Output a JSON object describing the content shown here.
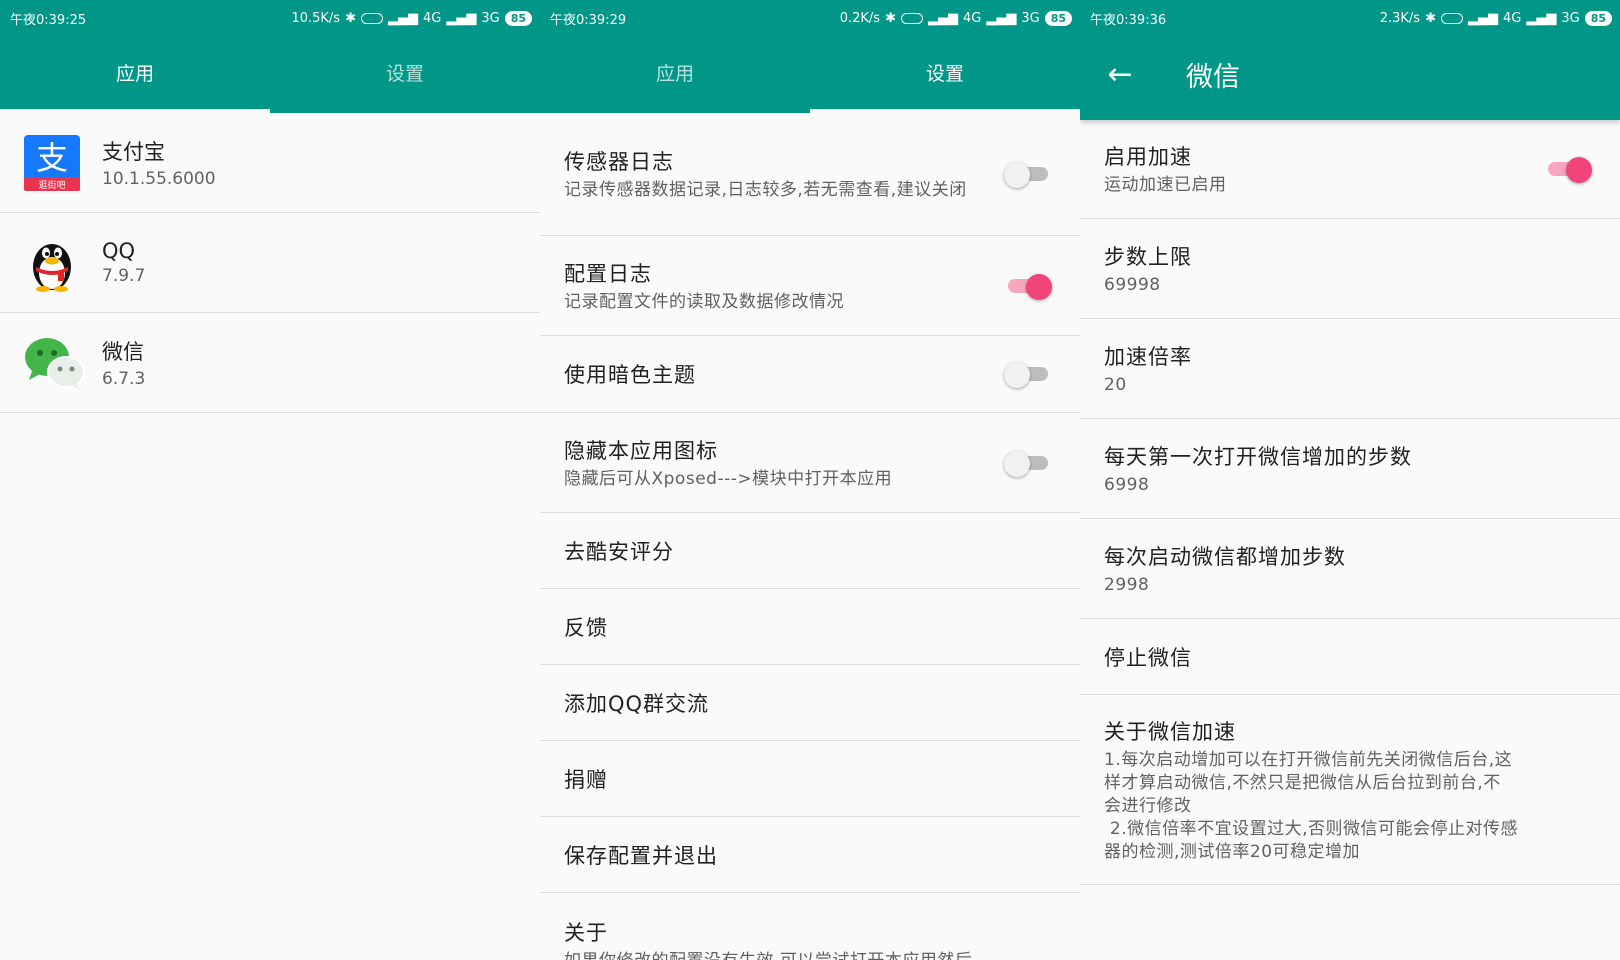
{
  "panels": [
    {
      "status": {
        "time": "午夜0:39:25",
        "speed": "10.5K/s",
        "net1": "4G",
        "net2": "3G",
        "battery": "85"
      },
      "tabs": [
        {
          "label": "应用"
        },
        {
          "label": "设置"
        }
      ],
      "apps": [
        {
          "name": "支付宝",
          "version": "10.1.55.6000",
          "icon": "alipay-icon",
          "color": "#1677ff",
          "badge": "逛街吧"
        },
        {
          "name": "QQ",
          "version": "7.9.7",
          "icon": "qq-penguin-icon"
        },
        {
          "name": "微信",
          "version": "6.7.3",
          "icon": "wechat-icon",
          "color": "#44b549"
        }
      ]
    },
    {
      "status": {
        "time": "午夜0:39:29",
        "speed": "0.2K/s",
        "net1": "4G",
        "net2": "3G",
        "battery": "85"
      },
      "tabs": [
        {
          "label": "应用"
        },
        {
          "label": "设置"
        }
      ],
      "prefs": [
        {
          "title": "传感器日志",
          "summary": "记录传感器数据记录,日志较多,若无需查看,建议关闭",
          "switch_on": false
        },
        {
          "title": "配置日志",
          "summary": "记录配置文件的读取及数据修改情况",
          "switch_on": true
        },
        {
          "title": "使用暗色主题",
          "switch_on": false
        },
        {
          "title": "隐藏本应用图标",
          "summary": "隐藏后可从Xposed--->模块中打开本应用",
          "switch_on": false
        },
        {
          "title": "去酷安评分"
        },
        {
          "title": "反馈"
        },
        {
          "title": "添加QQ群交流"
        },
        {
          "title": "捐赠"
        },
        {
          "title": "保存配置并退出"
        },
        {
          "title": "关于",
          "summary": "如果你修改的配置没有生效,可以尝试打开本应用然后"
        }
      ]
    },
    {
      "status": {
        "time": "午夜0:39:36",
        "speed": "2.3K/s",
        "net1": "4G",
        "net2": "3G",
        "battery": "85"
      },
      "title": "微信",
      "prefs": [
        {
          "title": "启用加速",
          "summary": "运动加速已启用",
          "switch_on": true
        },
        {
          "title": "步数上限",
          "summary": "69998"
        },
        {
          "title": "加速倍率",
          "summary": "20"
        },
        {
          "title": "每天第一次打开微信增加的步数",
          "summary": "6998"
        },
        {
          "title": "每次启动微信都增加步数",
          "summary": "2998"
        },
        {
          "title": "停止微信"
        },
        {
          "title": "关于微信加速",
          "summary_lines": [
            "1.每次启动增加可以在打开微信前先关闭微信后台,这",
            "样才算启动微信,不然只是把微信从后台拉到前台,不",
            "会进行修改",
            " 2.微信倍率不宜设置过大,否则微信可能会停止对传感",
            "器的检测,测试倍率20可稳定增加"
          ]
        }
      ]
    }
  ],
  "colors": {
    "primary": "#009688",
    "accent": "#f0447a",
    "accent_track": "#f7a6bd"
  }
}
